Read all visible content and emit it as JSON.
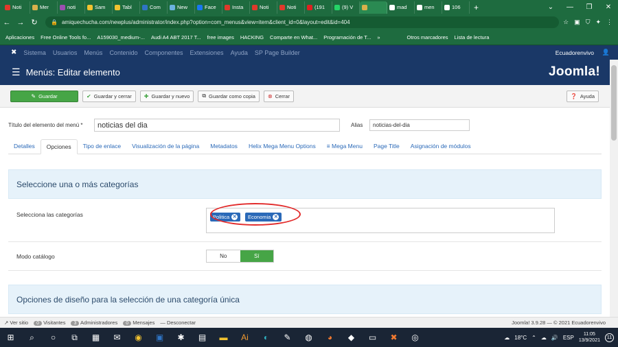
{
  "browser": {
    "tabs": [
      {
        "label": "Noti",
        "color": "#e0392b"
      },
      {
        "label": "Mer",
        "color": "#d8b04b"
      },
      {
        "label": "noti",
        "color": "#9a4fb0"
      },
      {
        "label": "Sam",
        "color": "#f2c230"
      },
      {
        "label": "Tabl",
        "color": "#f2c230"
      },
      {
        "label": "Com",
        "color": "#2f74c4"
      },
      {
        "label": "New",
        "color": "#6bb3e0"
      },
      {
        "label": "Face",
        "color": "#1877f2"
      },
      {
        "label": "Insta",
        "color": "#e0392b"
      },
      {
        "label": "Noti",
        "color": "#e0392b"
      },
      {
        "label": "Noti",
        "color": "#e0392b"
      },
      {
        "label": "(191",
        "color": "#e02020"
      },
      {
        "label": "(9) V",
        "color": "#25d366"
      },
      {
        "label": "",
        "color": "#d8b04b"
      },
      {
        "label": "mad",
        "color": "#ffffff"
      },
      {
        "label": "men",
        "color": "#ffffff"
      },
      {
        "label": "106",
        "color": "#ffffff"
      }
    ],
    "url": "amiquechucha.com/newplus/administrator/index.php?option=com_menus&view=item&client_id=0&layout=edit&id=404",
    "bookmarks": [
      "Aplicaciones",
      "Free Online Tools fo...",
      "A159030_medium-...",
      "Audi A4 ABT 2017 T...",
      "free images",
      "HACKING",
      "Comparte en What...",
      "Programación de T...",
      "»",
      "Otros marcadores",
      "Lista de lectura"
    ]
  },
  "joomla_nav": {
    "items": [
      "Sistema",
      "Usuarios",
      "Menús",
      "Contenido",
      "Componentes",
      "Extensiones",
      "Ayuda",
      "SP Page Builder"
    ],
    "site": "Ecuadorenvivo"
  },
  "header": {
    "title": "Menús: Editar elemento",
    "brand": "Joomla!"
  },
  "toolbar": {
    "save": "Guardar",
    "save_close": "Guardar y cerrar",
    "save_new": "Guardar y nuevo",
    "save_copy": "Guardar como copia",
    "close": "Cerrar",
    "help": "Ayuda"
  },
  "form": {
    "title_label": "Título del elemento del menú *",
    "title_value": "noticias del dia",
    "alias_label": "Alias",
    "alias_value": "noticias-del-dia"
  },
  "tabs": [
    "Detalles",
    "Opciones",
    "Tipo de enlace",
    "Visualización de la página",
    "Metadatos",
    "Helix Mega Menu Options",
    "≡ Mega Menu",
    "Page Title",
    "Asignación de módulos"
  ],
  "sections": {
    "categories_heading": "Seleccione una o más categorías",
    "categories_label": "Selecciona las categorías",
    "chips": [
      "Politica",
      "Economia"
    ],
    "catalog_label": "Modo catálogo",
    "catalog_no": "No",
    "catalog_yes": "Sí",
    "design_heading": "Opciones de diseño para la selección de una categoría única"
  },
  "status": {
    "view_site": "Ver sitio",
    "visitors": "0",
    "visitors_label": "Visitantes",
    "admins": "3",
    "admins_label": "Administradores",
    "messages": "0",
    "messages_label": "Mensajes",
    "logout": "Desconectar",
    "version": "Joomla! 3.9.28 — © 2021 Ecuadorenvivo"
  },
  "taskbar": {
    "temp": "18°C",
    "lang": "ESP",
    "time": "11:05",
    "date": "13/9/2021",
    "notif": "11"
  }
}
